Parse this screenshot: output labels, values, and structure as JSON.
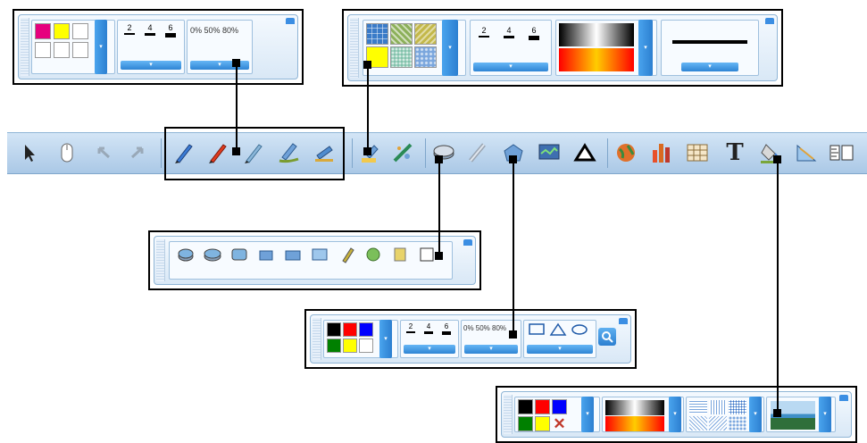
{
  "color_palette": [
    "#e6007e",
    "#ffff00",
    "#ffffff",
    "#ffffff",
    "#ffffff",
    "#ffffff"
  ],
  "shape_palette": [
    "#000000",
    "#ff0000",
    "#0000ff",
    "#008000",
    "#ffff00",
    "#ffffff"
  ],
  "fill_palette": [
    "#000000",
    "#ff0000",
    "#0000ff",
    "#008000",
    "#ffff00"
  ],
  "line_widths": [
    "2",
    "4",
    "6"
  ],
  "opacity_values": "0% 50% 80%",
  "pattern_palette": [
    "#3a7bc8",
    "#8cb05a",
    "#c3b84a",
    "#ffff00",
    "#7cc0a8",
    "#7aa6dd"
  ],
  "gradient_colors": [
    "#000000",
    "#ffffff",
    "#ff0000",
    "#ffcc00"
  ],
  "dropdown_arrow": "▾",
  "shape_choices": [
    "rectangle-shape-icon",
    "triangle-shape-icon",
    "ellipse-shape-icon"
  ],
  "toolbar": {
    "text_tool_label": "T"
  }
}
